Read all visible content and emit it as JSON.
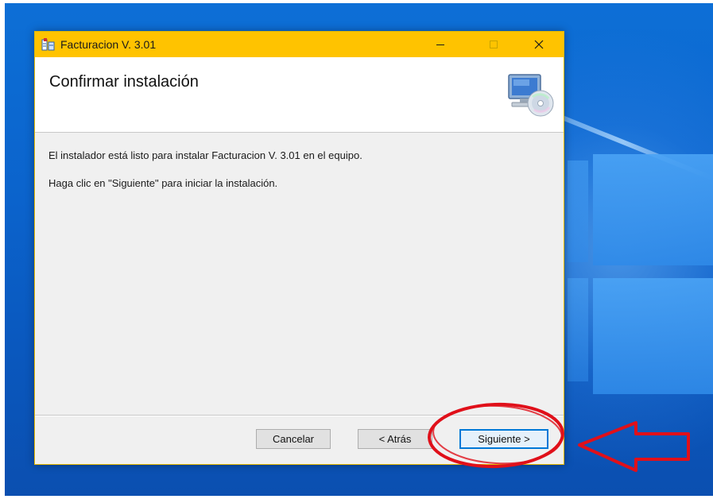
{
  "window": {
    "title": "Facturacion V. 3.01",
    "titlebar_color": "#ffc300",
    "controls": {
      "minimize_icon": "minimize-icon",
      "maximize_icon": "maximize-icon",
      "close_icon": "close-icon"
    }
  },
  "header": {
    "title": "Confirmar instalación",
    "icon": "computer-cd-icon"
  },
  "body": {
    "line1": "El instalador está listo para instalar Facturacion V. 3.01 en el equipo.",
    "line2": "Haga clic en \"Siguiente\" para iniciar la instalación."
  },
  "buttons": {
    "cancel": "Cancelar",
    "back": "< Atrás",
    "next": "Siguiente >"
  },
  "annotation": {
    "color": "#e0101a",
    "shapes": [
      "ellipse",
      "arrow-left"
    ]
  }
}
